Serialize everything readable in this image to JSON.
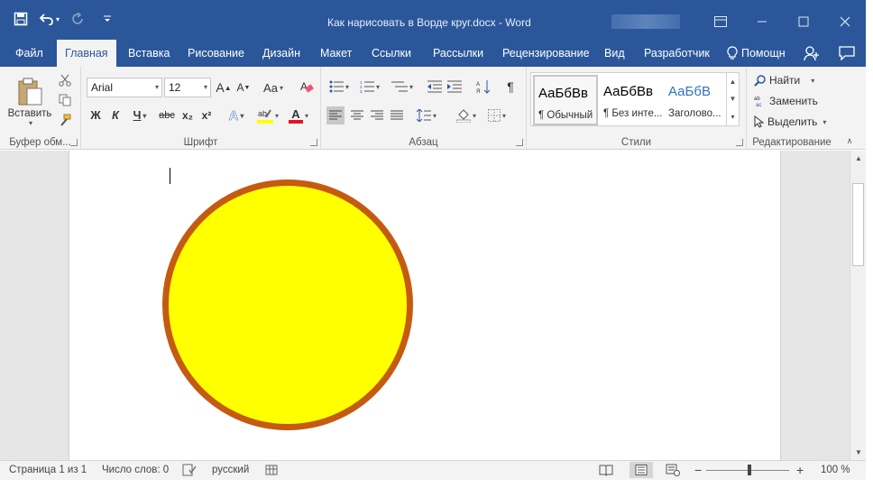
{
  "title_bar": {
    "document_title": "Как нарисовать в Ворде круг.docx  -  Word",
    "quick_access": [
      "save-icon",
      "undo-icon",
      "redo-icon",
      "customize-icon"
    ],
    "window_controls": [
      "ribbon-display-icon",
      "minimize-icon",
      "restore-icon",
      "close-icon"
    ]
  },
  "tabs": [
    {
      "label": "Файл"
    },
    {
      "label": "Главная",
      "active": true
    },
    {
      "label": "Вставка"
    },
    {
      "label": "Рисование"
    },
    {
      "label": "Дизайн"
    },
    {
      "label": "Макет"
    },
    {
      "label": "Ссылки"
    },
    {
      "label": "Рассылки"
    },
    {
      "label": "Рецензирование"
    },
    {
      "label": "Вид"
    },
    {
      "label": "Разработчик"
    }
  ],
  "help": {
    "label": "Помощн"
  },
  "ribbon": {
    "clipboard": {
      "label": "Буфер обм...",
      "paste_label": "Вставить"
    },
    "font": {
      "label": "Шрифт",
      "font_name": "Arial",
      "font_size": "12",
      "bold": "Ж",
      "italic": "К",
      "underline": "Ч",
      "strike": "abc",
      "subscript": "x₂",
      "superscript": "x²",
      "grow": "A",
      "shrink": "A",
      "change_case": "Aa",
      "text_effects": "A",
      "font_color": "A",
      "highlight_color": "#ffff00",
      "font_color_value": "#e81123"
    },
    "paragraph": {
      "label": "Абзац",
      "pilcrow": "¶"
    },
    "styles": {
      "label": "Стили",
      "items": [
        {
          "sample": "АаБбВв",
          "name": "¶ Обычный"
        },
        {
          "sample": "АаБбВв",
          "name": "¶ Без инте..."
        },
        {
          "sample": "АаБбВ",
          "name": "Заголово..."
        }
      ]
    },
    "editing": {
      "label": "Редактирование",
      "find": "Найти",
      "replace": "Заменить",
      "select": "Выделить"
    }
  },
  "document": {
    "shape": {
      "type": "circle",
      "fill": "#ffff00",
      "outline": "#c55a11"
    }
  },
  "status_bar": {
    "page": "Страница 1 из 1",
    "words": "Число слов: 0",
    "language": "русский",
    "zoom_minus": "−",
    "zoom_plus": "+",
    "zoom": "100 %",
    "zoom_percent": 100
  }
}
